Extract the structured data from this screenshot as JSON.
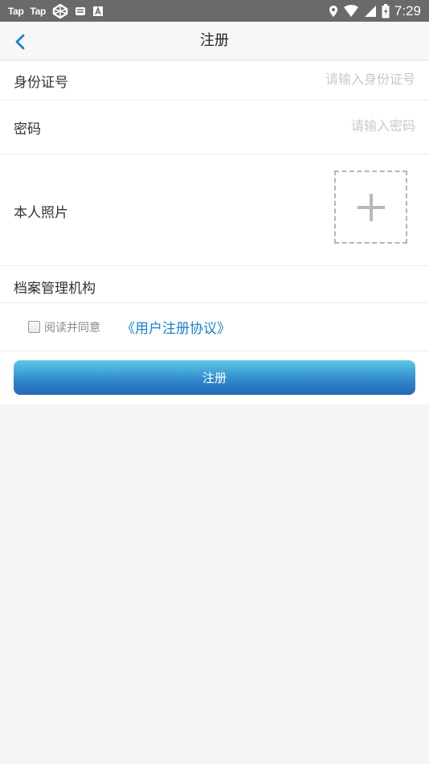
{
  "status_bar": {
    "app_labels": [
      "Tap",
      "Tap"
    ],
    "time": "7:29",
    "icons": [
      "taptap-icon",
      "taptap-icon",
      "app-icon",
      "mail-icon",
      "a-icon",
      "location-icon",
      "wifi-icon",
      "signal-icon",
      "battery-icon"
    ]
  },
  "navbar": {
    "title": "注册",
    "back_icon": "chevron-left-icon"
  },
  "form": {
    "id_label": "身份证号",
    "id_placeholder": "请输入身份证号",
    "password_label": "密码",
    "password_placeholder": "请输入密码",
    "photo_label": "本人照片",
    "photo_icon": "plus-icon",
    "archive_label": "档案管理机构",
    "agree_text": "阅读并同意",
    "agreement_link": "《用户注册协议》",
    "submit_label": "注册"
  },
  "colors": {
    "accent": "#1a7fd6",
    "button_top": "#5cc8e6",
    "button_bottom": "#2468b6",
    "status_bar": "#6a6a6a"
  }
}
